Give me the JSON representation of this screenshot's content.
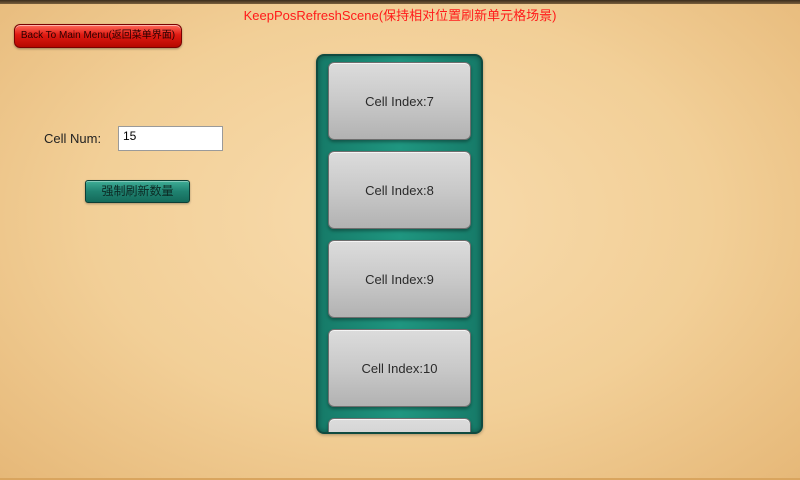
{
  "scene": {
    "title": "KeepPosRefreshScene(保持相对位置刷新单元格场景)"
  },
  "back_button": {
    "label": "Back To Main Menu(返回菜单界面)"
  },
  "controls": {
    "cell_num_label": "Cell Num:",
    "cell_num_value": "15",
    "refresh_button_label": "强制刷新数量"
  },
  "cells": [
    {
      "label": "Cell Index:7"
    },
    {
      "label": "Cell Index:8"
    },
    {
      "label": "Cell Index:9"
    },
    {
      "label": "Cell Index:10"
    },
    {
      "label": ""
    }
  ],
  "colors": {
    "title": "#ff1a1a",
    "back_button": "#e01a12",
    "refresh_button": "#1f8270",
    "panel": "#1f9680",
    "background": "#f2cf97"
  }
}
